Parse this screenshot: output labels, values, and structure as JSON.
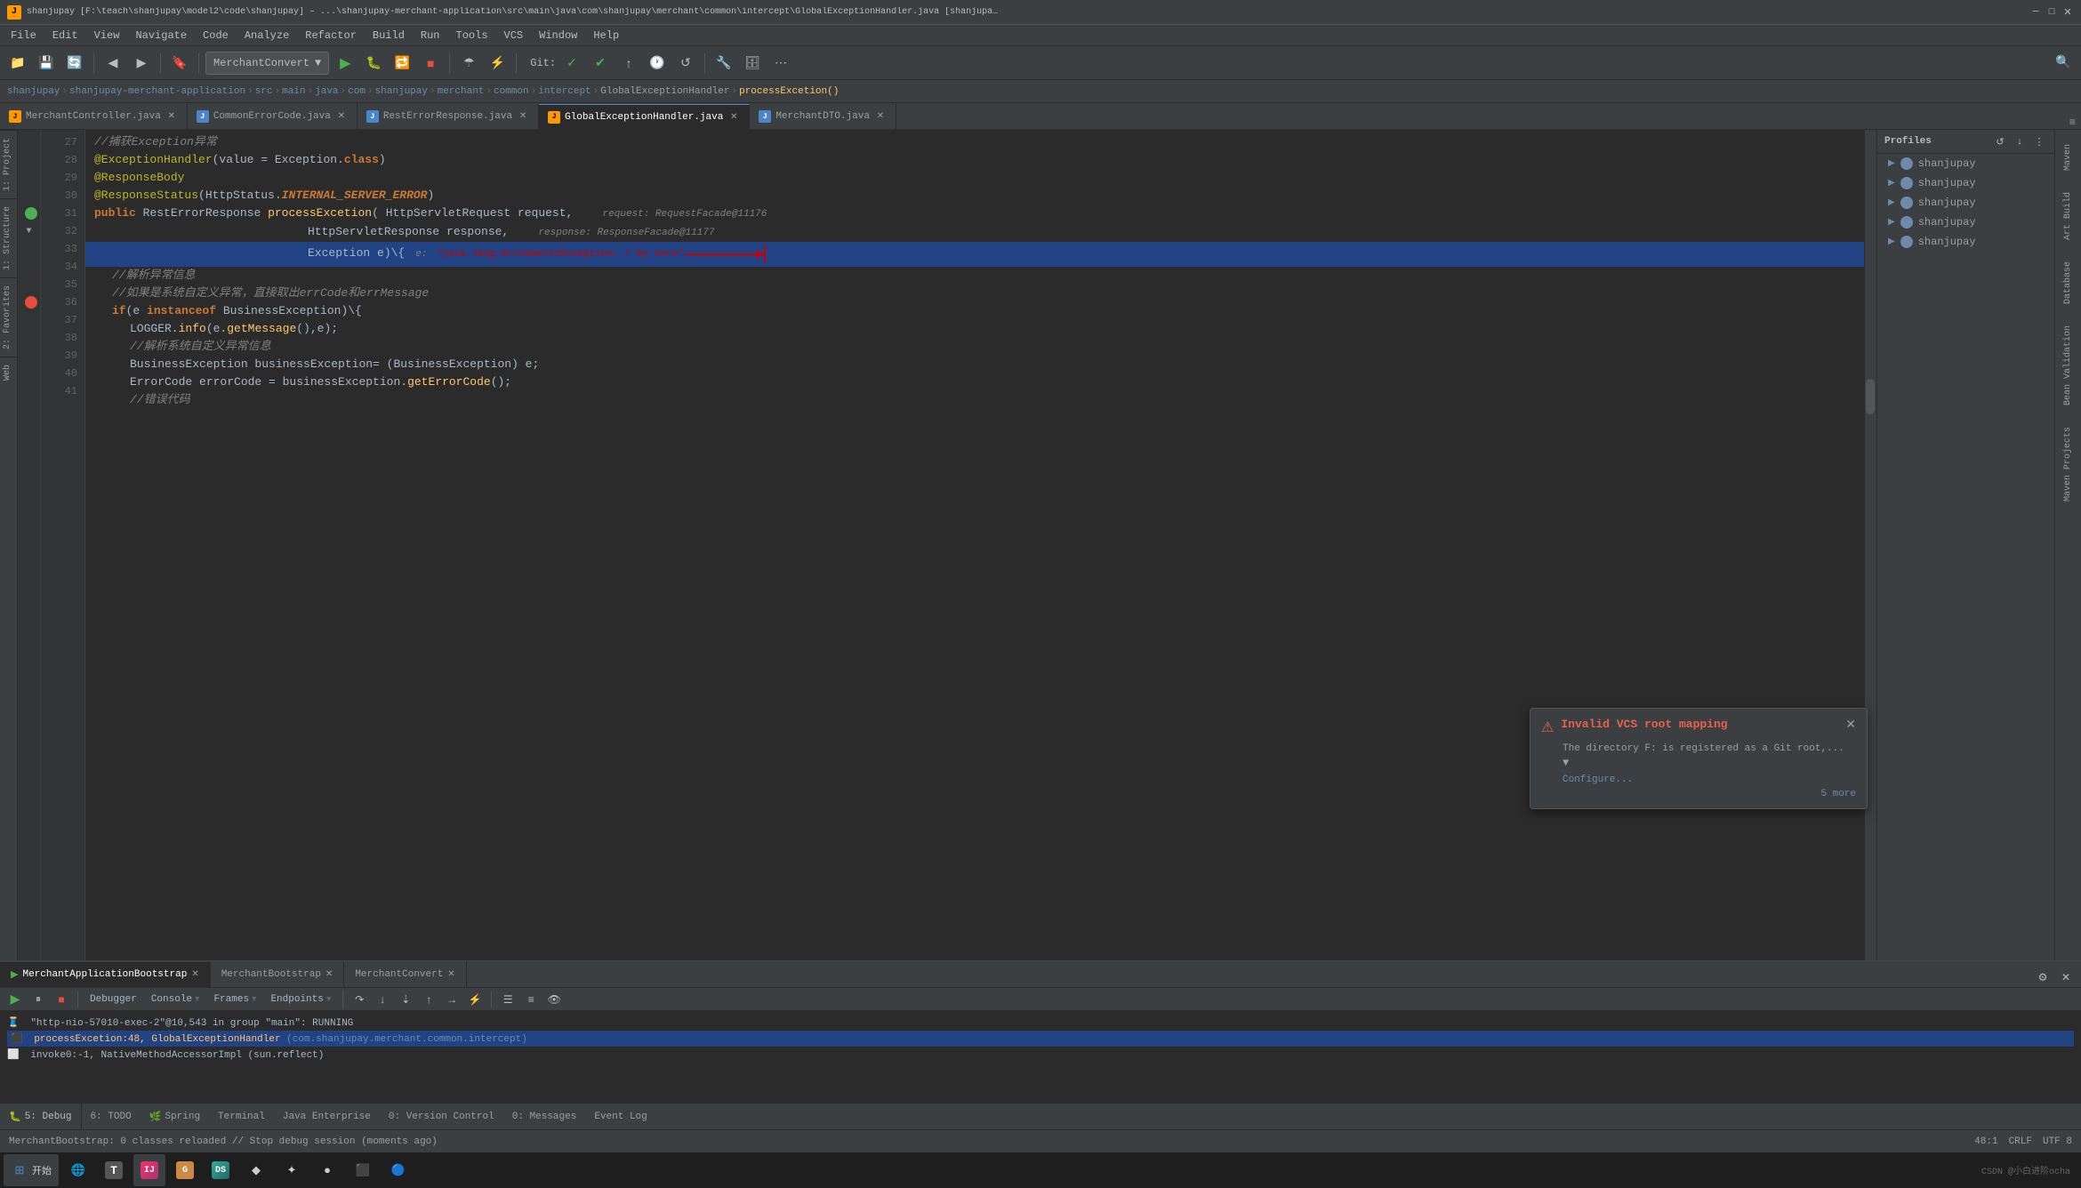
{
  "titleBar": {
    "title": "shanjupay [F:\\teach\\shanjupay\\model2\\code\\shanjupay] – ...\\shanjupay-merchant-application\\src\\main\\java\\com\\shanjupay\\merchant\\common\\intercept\\GlobalExceptionHandler.java [shanjupa…",
    "icons": [
      "minimize",
      "maximize",
      "close"
    ]
  },
  "menuBar": {
    "items": [
      "File",
      "Edit",
      "View",
      "Navigate",
      "Code",
      "Analyze",
      "Refactor",
      "Build",
      "Run",
      "Tools",
      "VCS",
      "Window",
      "Help"
    ]
  },
  "toolbar": {
    "dropdown": "MerchantConvert",
    "git_label": "Git:",
    "buttons": [
      "folder",
      "save",
      "refresh",
      "back",
      "forward",
      "bookmark",
      "run",
      "debug",
      "reload",
      "stop",
      "build-run",
      "debug-run",
      "coverage",
      "profile",
      "git-check",
      "git-commit",
      "git-push",
      "git-history",
      "git-rollback",
      "wrench",
      "database",
      "toolbar-more"
    ]
  },
  "breadcrumb": {
    "items": [
      "shanjupay",
      "shanjupay-merchant-application",
      "src",
      "main",
      "java",
      "com",
      "shanjupay",
      "merchant",
      "common",
      "intercept",
      "GlobalExceptionHandler",
      "processExcetion()"
    ]
  },
  "fileTabs": {
    "tabs": [
      {
        "name": "MerchantController.java",
        "type": "java",
        "active": false
      },
      {
        "name": "CommonErrorCode.java",
        "type": "j",
        "active": false
      },
      {
        "name": "RestErrorResponse.java",
        "type": "j",
        "active": false
      },
      {
        "name": "GlobalExceptionHandler.java",
        "type": "java",
        "active": true
      },
      {
        "name": "MerchantDTO.java",
        "type": "j",
        "active": false
      }
    ]
  },
  "codeLines": [
    {
      "num": 27,
      "content": "//捕获Exception异常",
      "type": "comment"
    },
    {
      "num": 28,
      "content": "@ExceptionHandler(value = Exception.class)",
      "type": "annotation"
    },
    {
      "num": 29,
      "content": "@ResponseBody",
      "type": "annotation"
    },
    {
      "num": 30,
      "content": "@ResponseStatus(HttpStatus.INTERNAL_SERVER_ERROR)",
      "type": "annotation"
    },
    {
      "num": 31,
      "content": "public RestErrorResponse processExcetion( HttpServletRequest request,  request: RequestFacade@11176",
      "type": "code"
    },
    {
      "num": 32,
      "content": "                                          HttpServletResponse response,  response: ResponseFacade@11177",
      "type": "code"
    },
    {
      "num": 33,
      "content": "                                          Exception e){  e: \"java.lang.ArithmeticException: / by zero\"",
      "type": "code-highlight"
    },
    {
      "num": 34,
      "content": "    //解析异常信息",
      "type": "comment"
    },
    {
      "num": 35,
      "content": "    //如果是系统自定义异常，直接取出errCode和errMessage",
      "type": "comment"
    },
    {
      "num": 36,
      "content": "    if(e instanceof BusinessException){",
      "type": "code"
    },
    {
      "num": 37,
      "content": "        LOGGER.info(e.getMessage(),e);",
      "type": "code"
    },
    {
      "num": 38,
      "content": "        //解析系统自定义异常信息",
      "type": "comment"
    },
    {
      "num": 39,
      "content": "        BusinessException businessException= (BusinessException) e;",
      "type": "code"
    },
    {
      "num": 40,
      "content": "        ErrorCode errorCode = businessException.getErrorCode();",
      "type": "code"
    },
    {
      "num": 41,
      "content": "        //错误代码",
      "type": "comment"
    }
  ],
  "rightSidebar": {
    "title": "Profiles",
    "items": [
      "shanjupay",
      "shanjupay",
      "shanjupay",
      "shanjupay",
      "shanjupay"
    ],
    "buttons": [
      "refresh",
      "download",
      "more"
    ]
  },
  "debugPanel": {
    "tabs": [
      "MerchantApplicationBootstrap",
      "MerchantBootstrap",
      "MerchantConvert"
    ],
    "toolbar": [
      "resume",
      "pause",
      "stop",
      "step-over",
      "step-into",
      "step-out",
      "run-to-cursor",
      "evaluate",
      "frames",
      "mute"
    ],
    "subtabs": [
      "Debugger",
      "Console",
      "Frames",
      "Endpoints"
    ],
    "lines": [
      {
        "text": "\"http-nio-57010-exec-2\"@10,543 in group \"main\": RUNNING",
        "active": false
      },
      {
        "text": "processExcetion:48, GlobalExceptionHandler (com.shanjupay.merchant.common.intercept)",
        "active": true
      },
      {
        "text": "invoke0:-1, NativeMethodAccessorImpl (sun.reflect)",
        "active": false
      }
    ]
  },
  "notification": {
    "title": "Invalid VCS root mapping",
    "body": "The directory F: is registered as a Git root,...",
    "link": "Configure...",
    "more": "5 more"
  },
  "statusBar": {
    "left": "MerchantBootstrap: 0 classes reloaded // Stop debug session (moments ago)",
    "position": "48:1",
    "encoding": "CRLF",
    "charset": "UTF 8"
  },
  "taskbar": {
    "items": [
      {
        "icon": "⊞",
        "label": "开始",
        "color": "#4a86c8"
      },
      {
        "icon": "🌐",
        "label": "Chrome",
        "color": "#4a9"
      },
      {
        "icon": "T",
        "label": "Typora",
        "color": "#444"
      },
      {
        "icon": "IJ",
        "label": "IntelliJ",
        "color": "#e36"
      },
      {
        "icon": "G",
        "label": "Git",
        "color": "#f5a"
      },
      {
        "icon": "DS",
        "label": "DataGrip",
        "color": "#3a9"
      },
      {
        "icon": "◆",
        "label": "App",
        "color": "#c84"
      },
      {
        "icon": "✦",
        "label": "App2",
        "color": "#648"
      },
      {
        "icon": "●",
        "label": "App3",
        "color": "#666"
      },
      {
        "icon": "⬛",
        "label": "App4",
        "color": "#444"
      },
      {
        "icon": "🔵",
        "label": "App5",
        "color": "#36c"
      }
    ]
  },
  "bottomTabs": {
    "tabs": [
      {
        "num": "5",
        "label": "Debug"
      },
      {
        "num": "6",
        "label": "TODO"
      },
      {
        "label": "Spring"
      },
      {
        "label": "Terminal"
      },
      {
        "label": "Java Enterprise"
      },
      {
        "num": "0",
        "label": "Version Control"
      },
      {
        "num": "0",
        "label": "Messages"
      },
      {
        "label": "Event Log"
      }
    ]
  },
  "leftPanels": [
    "Project",
    "Structure",
    "Favorites"
  ],
  "rightPanels": [
    "Maven",
    "Art Build",
    "Database",
    "Bean Validation",
    "Maven Projects"
  ],
  "watermark": "CSDN @小白进阶ocha"
}
